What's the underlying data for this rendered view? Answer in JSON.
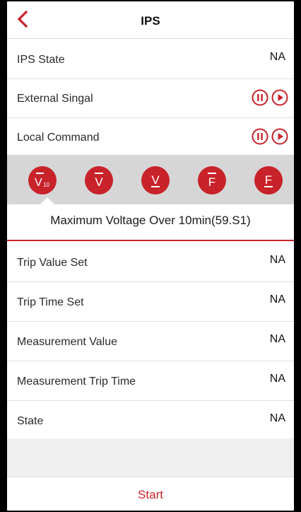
{
  "header": {
    "title": "IPS",
    "back_icon": "chevron-left-icon"
  },
  "status_rows": [
    {
      "label": "IPS State",
      "value": "NA"
    },
    {
      "label": "External Singal"
    },
    {
      "label": "Local Command"
    }
  ],
  "tabs": [
    {
      "symbol": "V",
      "subscript": "10",
      "icon": "voltage-10min-icon",
      "selected": true
    },
    {
      "symbol": "V",
      "icon": "overvoltage-icon"
    },
    {
      "symbol": "V",
      "icon": "undervoltage-icon"
    },
    {
      "symbol": "F",
      "icon": "overfrequency-icon"
    },
    {
      "symbol": "F",
      "icon": "underfrequency-icon"
    }
  ],
  "description": "Maximum Voltage Over 10min(59.S1)",
  "param_rows": [
    {
      "label": "Trip Value Set",
      "value": "NA"
    },
    {
      "label": "Trip Time Set",
      "value": "NA"
    },
    {
      "label": "Measurement Value",
      "value": "NA"
    },
    {
      "label": "Measurement Trip Time",
      "value": "NA"
    },
    {
      "label": "State",
      "value": "NA"
    }
  ],
  "footer": {
    "start_label": "Start"
  },
  "colors": {
    "accent": "#c8222a",
    "divider": "#dedede",
    "tab_bar": "#d6d6d6",
    "filler": "#efefef"
  }
}
